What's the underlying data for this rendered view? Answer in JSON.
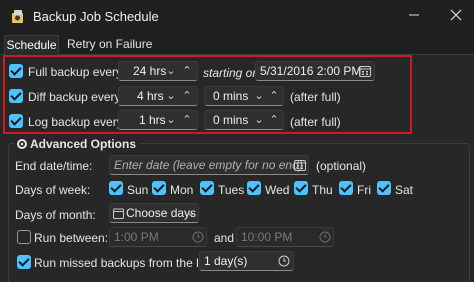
{
  "window": {
    "title": "Backup Job Schedule"
  },
  "tabs": [
    {
      "label": "Schedule"
    },
    {
      "label": "Retry on Failure"
    }
  ],
  "backups": {
    "full": {
      "label": "Full backup every",
      "interval": "24 hrs",
      "starting_on_label": "starting on",
      "start_datetime": "5/31/2016 2:00 PM"
    },
    "diff": {
      "label": "Diff backup every",
      "interval": "4 hrs",
      "offset": "0 mins",
      "after_full_label": "(after full)"
    },
    "log": {
      "label": "Log backup every",
      "interval": "1 hrs",
      "offset": "0 mins",
      "after_full_label": "(after full)"
    }
  },
  "advanced": {
    "title": "Advanced Options",
    "end_date": {
      "label": "End date/time:",
      "placeholder": "Enter date (leave empty for no end)",
      "optional_label": "(optional)"
    },
    "days_of_week": {
      "label": "Days of week:",
      "days": [
        "Sun",
        "Mon",
        "Tues",
        "Wed",
        "Thu",
        "Fri",
        "Sat"
      ]
    },
    "days_of_month": {
      "label": "Days of month:",
      "button_label": "Choose days"
    },
    "run_between": {
      "label": "Run between:",
      "from": "1:00 PM",
      "and_label": "and",
      "to": "10:00 PM"
    },
    "run_missed": {
      "label": "Run missed backups from the last:",
      "value": "1 day(s)"
    }
  },
  "colors": {
    "accent": "#4cc2ff",
    "highlight_border": "#d11a1a"
  }
}
